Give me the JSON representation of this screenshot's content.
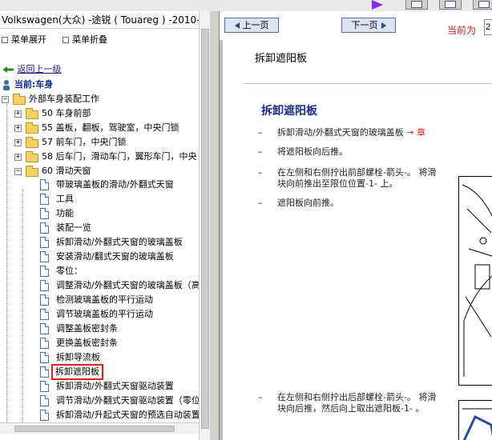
{
  "window": {
    "title": "Volkswagen(大众) -途锐 ( Touareg ) -2010-..."
  },
  "toolbar": {
    "buttons": [
      {
        "icon": "window-icon"
      },
      {
        "icon": "window-icon"
      },
      {
        "icon": "window-icon"
      }
    ]
  },
  "left": {
    "expand_all": "菜单展开",
    "collapse_all": "菜单折叠",
    "back_link": "返回上一级",
    "current_label": "当前:车身",
    "tree": {
      "root": "外部车身装配工作",
      "groups": [
        {
          "label": "50 车身前部"
        },
        {
          "label": "55 盖板，翻板，驾驶室，中央门锁"
        },
        {
          "label": "57 前车门，中央门锁"
        },
        {
          "label": "58 后车门，滑动车门，翼形车门，中央"
        },
        {
          "label": "60 滑动天窗"
        }
      ],
      "items": [
        "带玻璃盖板的滑动/外翻式天窗",
        "工具",
        "功能",
        "装配一览",
        "拆卸滑动/外翻式天窗的玻璃盖板",
        "安装滑动/翻式天窗的玻璃盖板",
        "零位：",
        "调整滑动/外翻式天窗的玻璃盖板（高",
        "检测玻璃盖板的平行运动",
        "调节玻璃盖板的平行运动",
        "调整盖板密封条",
        "更换盖板密封条",
        "拆卸导流板",
        "拆卸遮阳板",
        "拆卸滑动/外翻式天窗驱动装置",
        "调节滑动/外翻式天窗驱动装置（零位",
        "拆卸滑动/升起式天窗的预选自动装置"
      ],
      "selected_index": 13
    }
  },
  "right": {
    "prev_label": "上一页",
    "next_label": "下一页",
    "current_page_label": "当前为",
    "page_value": "2",
    "header": "拆卸遮阳板",
    "title": "拆卸遮阳板",
    "steps": [
      {
        "text": "拆卸滑动/外翻式天窗的玻璃盖板",
        "ref": "→ 章"
      },
      {
        "text": "将遮阳板向后推。",
        "ref": ""
      },
      {
        "text": "在左侧和右侧拧出前部螺栓-箭头-。 将滑块向前推出至限位位置-1- 上。",
        "ref": ""
      },
      {
        "text": "遮阳板向前推。",
        "ref": ""
      },
      {
        "text": "在左侧和右侧拧出后部螺栓-箭头-。 将滑块向后推，然后向上取出遮阳板-1- 。",
        "ref": ""
      }
    ]
  },
  "colors": {
    "selection_outline": "#e02020",
    "title_blue": "#1a2a8c",
    "current_page_red": "#d02020"
  }
}
